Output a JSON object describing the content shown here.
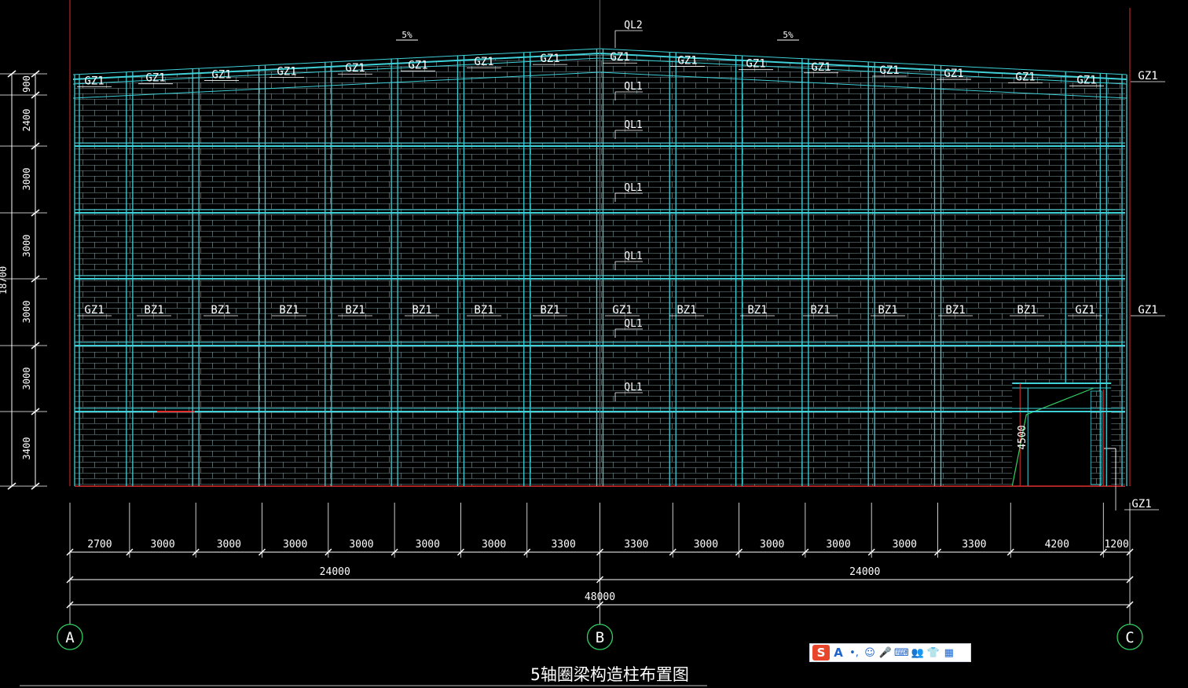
{
  "title": "5轴圈梁构造柱布置图",
  "bays": [
    "2700",
    "3000",
    "3000",
    "3000",
    "3000",
    "3000",
    "3000",
    "3300",
    "3300",
    "3000",
    "3000",
    "3000",
    "3000",
    "3300",
    "4200",
    "1200"
  ],
  "halves": [
    "24000",
    "24000"
  ],
  "total": "48000",
  "grids": [
    "A",
    "B",
    "C"
  ],
  "heights": [
    "900",
    "2400",
    "3000",
    "3000",
    "3000",
    "3000",
    "3400"
  ],
  "overall_height": "18700",
  "slopes": [
    "5%",
    "5%"
  ],
  "top_labels": [
    "GZ1",
    "GZ1",
    "GZ1",
    "GZ1",
    "GZ1",
    "GZ1",
    "GZ1",
    "GZ1",
    "GZ1",
    "GZ1",
    "GZ1",
    "GZ1",
    "GZ1",
    "GZ1",
    "GZ1",
    "GZ1"
  ],
  "mid_labels": [
    "GZ1",
    "BZ1",
    "BZ1",
    "BZ1",
    "BZ1",
    "BZ1",
    "BZ1",
    "BZ1",
    "GZ1",
    "BZ1",
    "BZ1",
    "BZ1",
    "BZ1",
    "BZ1",
    "BZ1",
    "GZ1"
  ],
  "right_labels": [
    "GZ1",
    "GZ1",
    "GZ1"
  ],
  "beam_labels": [
    "QL2",
    "QL1",
    "QL1",
    "QL1",
    "QL1",
    "QL1",
    "QL1"
  ],
  "door_height": "4500",
  "ime": {
    "logo": "S",
    "buttons": [
      "A",
      "•,",
      "☺",
      "🎤",
      "⌨",
      "👥",
      "👕",
      "▦"
    ]
  }
}
